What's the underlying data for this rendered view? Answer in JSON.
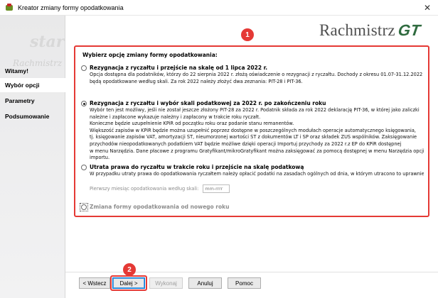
{
  "window": {
    "title": "Kreator zmiany formy opodatkowania",
    "close_glyph": "✕"
  },
  "logo": {
    "text": "Rachmistrz",
    "suffix": "GT"
  },
  "sidebar": {
    "ghost_text": "start",
    "ghost_text_2": "Rachmistrz",
    "items": [
      {
        "label": "Witamy!"
      },
      {
        "label": "Wybór opcji",
        "active": true
      },
      {
        "label": "Parametry"
      },
      {
        "label": "Podsumowanie"
      }
    ]
  },
  "badges": {
    "first": "1",
    "second": "2"
  },
  "panel": {
    "heading": "Wybierz opcję zmiany formy opodatkowania:",
    "options": [
      {
        "label": "Rezygnacja z ryczałtu i przejście na skalę od 1 lipca 2022 r.",
        "checked": false,
        "lines": [
          "Opcja dostępna dla podatników, którzy do 22 sierpnia 2022 r. złożą oświadczenie o rezygnacji z ryczałtu. Dochody z okresu 01.07-31.12.2022 r.",
          "będą opodatkowane według skali. Za rok 2022 należy złożyć dwa zeznania: PIT-28 i PIT-36."
        ]
      },
      {
        "label": "Rezygnacja z ryczałtu i wybór skali podatkowej za 2022 r. po zakończeniu roku",
        "checked": true,
        "lines": [
          "Wybór ten jest możliwy, jeśli nie został jeszcze złożony PIT-28 za 2022 r. Podatnik składa za rok 2022 deklarację PIT-36, w której jako zaliczki",
          "należne i zapłacone wykazuje należny i zapłacony w trakcie roku ryczałt.",
          "Konieczne będzie uzupełnienie KPiR od początku roku oraz podanie stanu remanentów.",
          "Większość zapisów w KPiR będzie można uzupełnić poprzez dostępne w poszczególnych modułach operacje automatycznego księgowania,",
          "tj. księgowanie zapisów VAT, amortyzacji ŚT, nieumorzonej wartości ŚT z dokumentów LT i SP oraz składek ZUS wspólników. Zaksięgowanie",
          "przychodów nieopodatkowanych podatkiem VAT będzie możliwe dzięki operacji Importuj przychody za 2022 r.z EP do KPiR dostępnej",
          "w menu Narzędzia. Dane płacowe z programu Gratyfikant/mikroGratyfikant można zaksięgować za pomocą dostępnej w menu Narzędzia opcji",
          "importu."
        ]
      },
      {
        "label": "Utrata prawa do ryczałtu w trakcie roku i przejście na skalę podatkową",
        "checked": false,
        "lines": [
          "W przypadku utraty prawa do opodatkowania ryczałtem należy opłacić podatki na zasadach ogólnych od dnia, w którym utracono to uprawnienie."
        ],
        "date_label": "Pierwszy miesiąc opodatkowania według skali:",
        "date_placeholder": "mm-rrrr"
      },
      {
        "label": "Zmiana formy opodatkowania od nowego roku",
        "checked": false,
        "disabled": true
      }
    ]
  },
  "buttons": {
    "prev": "< Wstecz",
    "next": "Dalej >",
    "execute": "Wykonaj",
    "cancel": "Anuluj",
    "help": "Pomoc"
  }
}
